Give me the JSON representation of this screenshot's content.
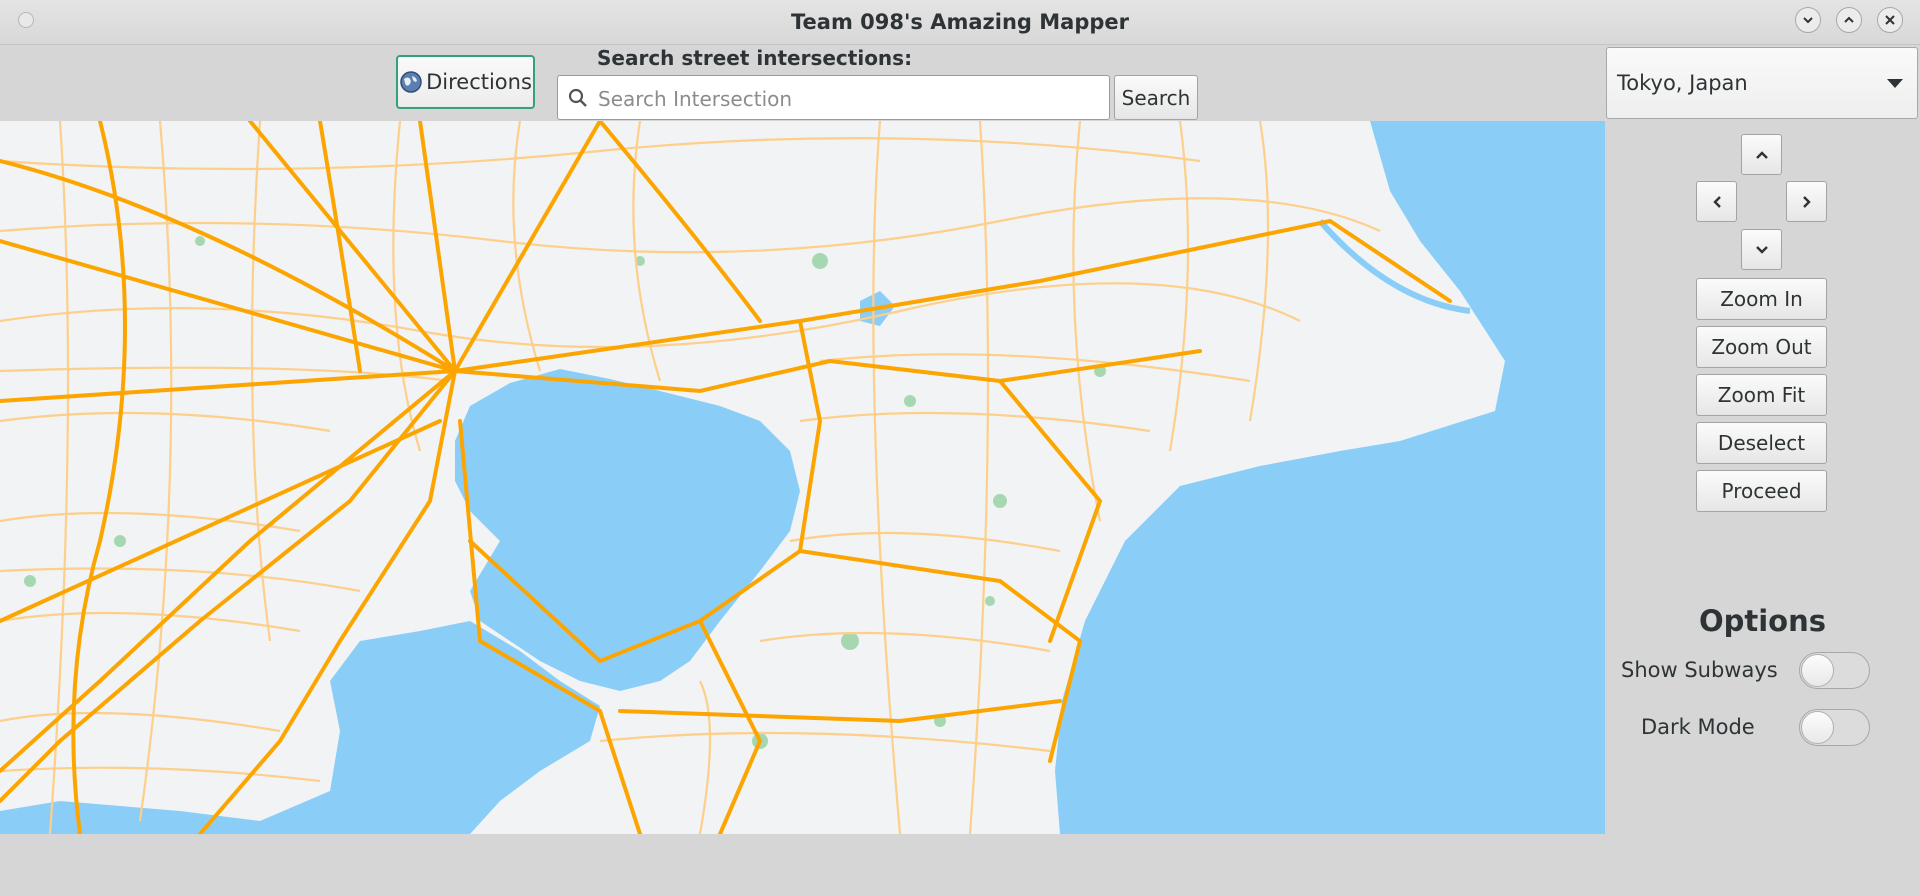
{
  "window": {
    "title": "Team 098's Amazing Mapper"
  },
  "toolbar": {
    "directions_label": "Directions",
    "search_label": "Search street intersections:",
    "search_placeholder": "Search Intersection",
    "search_value": "",
    "search_button": "Search"
  },
  "sidebar": {
    "city_selected": "Tokyo, Japan",
    "buttons": [
      "Zoom In",
      "Zoom Out",
      "Zoom Fit",
      "Deselect",
      "Proceed"
    ],
    "options_title": "Options",
    "options": [
      {
        "label": "Show Subways",
        "enabled": false
      },
      {
        "label": "Dark Mode",
        "enabled": false
      }
    ]
  },
  "map": {
    "region": "Tokyo Bay area",
    "colors": {
      "water": "#8acef8",
      "land": "#f1f3f4",
      "major_road": "#fca501",
      "minor_road": "#fdcf8a",
      "park": "#a5d8b0"
    }
  }
}
